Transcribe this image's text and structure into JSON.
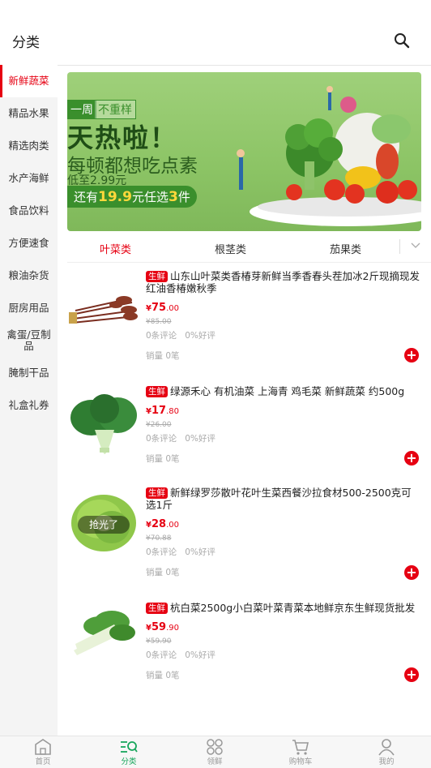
{
  "header": {
    "title": "分类",
    "search_icon": "search-icon"
  },
  "sidebar": {
    "items": [
      {
        "label": "新鲜蔬菜",
        "active": true
      },
      {
        "label": "精品水果"
      },
      {
        "label": "精选肉类"
      },
      {
        "label": "水产海鲜"
      },
      {
        "label": "食品饮料"
      },
      {
        "label": "方便速食"
      },
      {
        "label": "粮油杂货"
      },
      {
        "label": "厨房用品"
      },
      {
        "label": "禽蛋/豆制品"
      },
      {
        "label": "腌制干品"
      },
      {
        "label": "礼盒礼券"
      }
    ]
  },
  "banner": {
    "tag_left": "一周",
    "tag_right": "不重样",
    "headline": "天热啦！",
    "subline": "每顿都想吃点素",
    "price_line": "低至2.99元",
    "promo_pre": "还有",
    "promo_price": "19.9",
    "promo_mid": "元任选",
    "promo_count": "3",
    "promo_post": "件"
  },
  "subtabs": [
    {
      "label": "叶菜类",
      "active": true
    },
    {
      "label": "根茎类"
    },
    {
      "label": "茄果类"
    }
  ],
  "products": [
    {
      "badge": "生鲜",
      "name": "山东山叶菜类香椿芽新鲜当季香春头茬加冰2斤现摘现发红油香椿嫩秋季",
      "currency": "¥",
      "price_int": "75",
      "price_dec": ".00",
      "orig": "¥85.00",
      "reviews": "0条评论",
      "rating": "0%好评",
      "sales": "销量 0笔"
    },
    {
      "badge": "生鲜",
      "name": "绿源禾心 有机油菜 上海青 鸡毛菜 新鲜蔬菜 约500g",
      "currency": "¥",
      "price_int": "17",
      "price_dec": ".80",
      "orig": "¥26.00",
      "reviews": "0条评论",
      "rating": "0%好评",
      "sales": "销量 0笔"
    },
    {
      "badge": "生鲜",
      "name": "新鲜绿罗莎散叶花叶生菜西餐沙拉食材500-2500克可选1斤",
      "currency": "¥",
      "price_int": "28",
      "price_dec": ".00",
      "orig": "¥70.88",
      "reviews": "0条评论",
      "rating": "0%好评",
      "sales": "销量 0笔",
      "soldout": "抢光了"
    },
    {
      "badge": "生鲜",
      "name": "杭白菜2500g小白菜叶菜青菜本地鲜京东生鲜现货批发",
      "currency": "¥",
      "price_int": "59",
      "price_dec": ".90",
      "orig": "¥59.90",
      "reviews": "0条评论",
      "rating": "0%好评",
      "sales": "销量 0笔"
    }
  ],
  "tabbar": [
    {
      "label": "首页",
      "icon": "home-icon"
    },
    {
      "label": "分类",
      "icon": "category-icon",
      "active": true
    },
    {
      "label": "领鲜",
      "icon": "fresh-icon"
    },
    {
      "label": "购物车",
      "icon": "cart-icon"
    },
    {
      "label": "我的",
      "icon": "user-icon"
    }
  ],
  "colors": {
    "accent": "#e60012",
    "active_tab": "#18a65c"
  }
}
